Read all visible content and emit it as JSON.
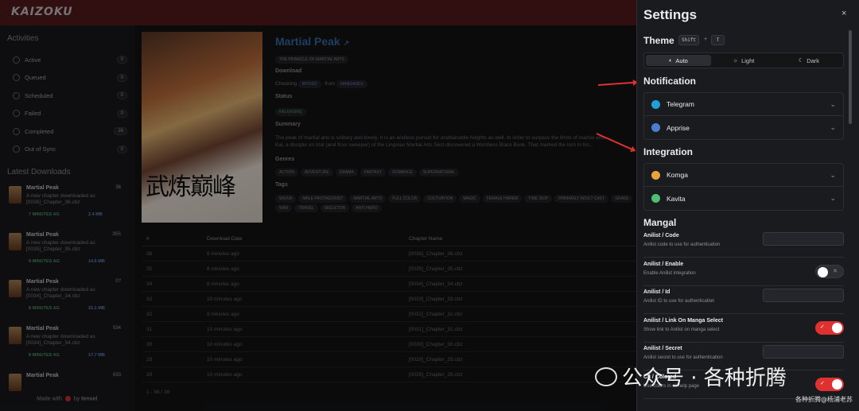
{
  "app": {
    "logo": "KAIZOKU",
    "made_with_prefix": "Made with",
    "made_with_suffix": "by",
    "author": "tensei"
  },
  "sidebar": {
    "activities_title": "Activities",
    "activities": [
      {
        "label": "Active",
        "count": "0"
      },
      {
        "label": "Queued",
        "count": "0"
      },
      {
        "label": "Scheduled",
        "count": "0"
      },
      {
        "label": "Failed",
        "count": "0"
      },
      {
        "label": "Completed",
        "count": "26"
      },
      {
        "label": "Out of Sync",
        "count": "0"
      }
    ],
    "downloads_title": "Latest Downloads",
    "downloads": [
      {
        "title": "Martial Peak",
        "num": "36",
        "desc": "A new chapter downloaded as [0036]_Chapter_36.cbz",
        "time": "7 MINUTES AG",
        "size": "2.4 MB"
      },
      {
        "title": "Martial Peak",
        "num": "35S",
        "desc": "A new chapter downloaded as [0035]_Chapter_35.cbz",
        "time": "8 MINUTES AG",
        "size": "14.6 MB"
      },
      {
        "title": "Martial Peak",
        "num": "0?",
        "desc": "A new chapter downloaded as [0034]_Chapter_34.cbz",
        "time": "8 MINUTES AG",
        "size": "15.1 MB"
      },
      {
        "title": "Martial Peak",
        "num": "534",
        "desc": "A new chapter downloaded as [0034]_Chapter_34.cbz",
        "time": "8 MINUTES AG",
        "size": "17.7 MB"
      },
      {
        "title": "Martial Peak",
        "num": "633",
        "desc": "",
        "time": "",
        "size": ""
      }
    ]
  },
  "manga": {
    "title": "Martial Peak",
    "alt_title": "THE PINNACLE OF MARTIAL ARTS",
    "download_label": "Download",
    "checking_prefix": "Checking",
    "source": "MYOSO",
    "from": "from",
    "source2": "MANGADEX",
    "status_label": "Status",
    "status": "RELEASING",
    "summary_label": "Summary",
    "summary_l1": "The peak of martial arts is solitary and lonely. It is an endless pursuit for unattainable heights as well. In order to surpass the limits of martial arts,",
    "summary_l2": "Kai, a disciple on trial (and floor sweeper) of the Lingxiao Martial Arts Sect discovered a Wordless Black Book. That marked the turn in his...",
    "genres_label": "Genres",
    "genres": [
      "ACTION",
      "ADVENTURE",
      "DRAMA",
      "FANTASY",
      "ROMANCE",
      "SUPERNATURAL"
    ],
    "tags_label": "Tags",
    "tags_l1": [
      "WUXIA",
      "MALE PROTAGONIST",
      "MARTIAL ARTS",
      "FULL COLOR",
      "CULTIVATION",
      "MAGIC",
      "FEMALE HAREM",
      "TIME SKIP",
      "PRIMARILY ADULT CAST",
      "GRAVE"
    ],
    "tags_l2": [
      "WAR",
      "TRAVEL",
      "SKELETON",
      "ANTI-HERO"
    ]
  },
  "table": {
    "headers": [
      "#",
      "Download Date",
      "Chapter Name"
    ],
    "rows": [
      [
        "38",
        "6 minutes ago",
        "[0036]_Chapter_36.cbz"
      ],
      [
        "35",
        "8 minutes ago",
        "[0035]_Chapter_35.cbz"
      ],
      [
        "34",
        "8 minutes ago",
        "[0034]_Chapter_34.cbz"
      ],
      [
        "33",
        "10 minutes ago",
        "[0033]_Chapter_33.cbz"
      ],
      [
        "32",
        "9 minutes ago",
        "[0032]_Chapter_32.cbz"
      ],
      [
        "31",
        "10 minutes ago",
        "[0031]_Chapter_31.cbz"
      ],
      [
        "30",
        "10 minutes ago",
        "[0030]_Chapter_30.cbz"
      ],
      [
        "29",
        "10 minutes ago",
        "[0029]_Chapter_29.cbz"
      ],
      [
        "28",
        "10 minutes ago",
        "[0028]_Chapter_28.cbz"
      ]
    ],
    "footer": "1 - 36 / 36"
  },
  "settings": {
    "title": "Settings",
    "close": "×",
    "theme_label": "Theme",
    "shortcut_key1": "Shift",
    "shortcut_plus": "+",
    "shortcut_key2": "T",
    "theme_options": [
      {
        "icon": "palette-icon",
        "glyph": "◐",
        "label": "Auto",
        "active": true
      },
      {
        "icon": "sun-icon",
        "glyph": "☼",
        "label": "Light",
        "active": false
      },
      {
        "icon": "moon-icon",
        "glyph": "☾",
        "label": "Dark",
        "active": false
      }
    ],
    "notification_label": "Notification",
    "notifications": [
      {
        "label": "Telegram",
        "icon": "telegram-icon",
        "color": "#229ed9"
      },
      {
        "label": "Apprise",
        "icon": "apprise-icon",
        "color": "#4a7fd0"
      }
    ],
    "integration_label": "Integration",
    "integrations": [
      {
        "label": "Komga",
        "icon": "komga-icon",
        "color": "#e8a33d"
      },
      {
        "label": "Kavita",
        "icon": "kavita-icon",
        "color": "#4cbf73"
      }
    ],
    "mangal_label": "Mangal",
    "mangal_rows": [
      {
        "label": "Anilist / Code",
        "desc": "Anilist code to use for authentication",
        "control": "input"
      },
      {
        "label": "Anilist / Enable",
        "desc": "Enable Anilist integration",
        "control": "toggle-off"
      },
      {
        "label": "Anilist / Id",
        "desc": "Anilist ID to use for authentication",
        "control": "input"
      },
      {
        "label": "Anilist / Link On Manga Select",
        "desc": "Show link to Anilist on manga select",
        "control": "toggle-on"
      },
      {
        "label": "Anilist / Secret",
        "desc": "Anilist secret to use for authentication",
        "control": "input"
      },
      {
        "label": "Cli / Colored",
        "desc": "Use colors in cli help page",
        "control": "toggle-on"
      }
    ]
  },
  "watermark": {
    "text": "公众号 · 各种折腾",
    "sub": "各种折腾@杨浦老苏"
  },
  "colors": {
    "accent": "#e03131",
    "panel_bg": "#1a1b1e",
    "topbar": "#5a1a1c"
  }
}
